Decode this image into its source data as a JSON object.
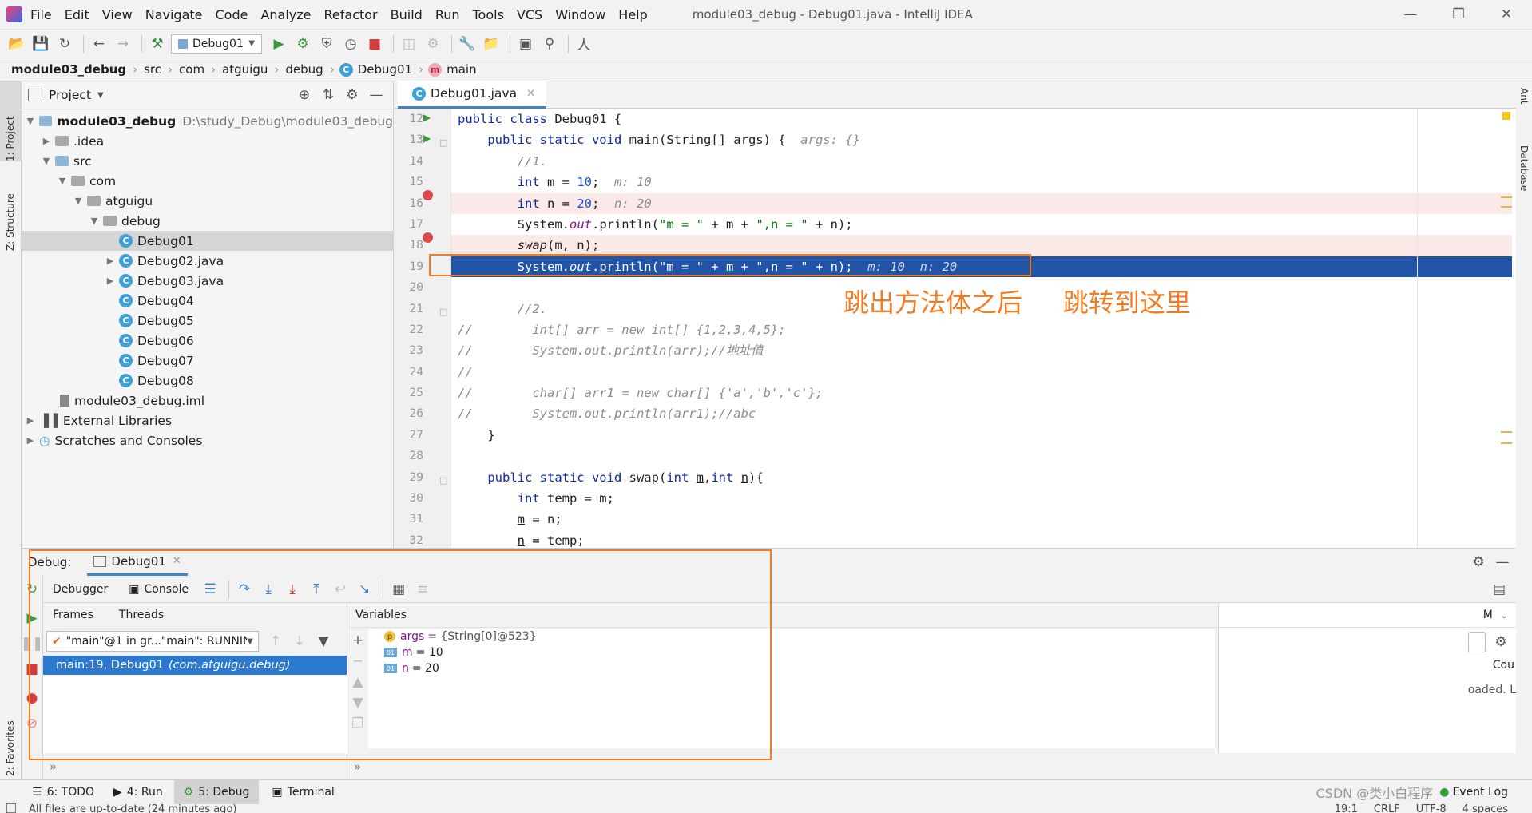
{
  "window": {
    "title": "module03_debug - Debug01.java - IntelliJ IDEA",
    "menu": [
      "File",
      "Edit",
      "View",
      "Navigate",
      "Code",
      "Analyze",
      "Refactor",
      "Build",
      "Run",
      "Tools",
      "VCS",
      "Window",
      "Help"
    ]
  },
  "toolbar": {
    "run_config": "Debug01"
  },
  "breadcrumb": [
    "module03_debug",
    "src",
    "com",
    "atguigu",
    "debug",
    "Debug01",
    "main"
  ],
  "side_tabs": {
    "project": "1: Project",
    "structure": "Z: Structure",
    "favorites": "2: Favorites",
    "ant": "Ant",
    "database": "Database"
  },
  "project": {
    "title": "Project",
    "root_name": "module03_debug",
    "root_path": "D:\\study_Debug\\module03_debug",
    "idea": ".idea",
    "src": "src",
    "com": "com",
    "atguigu": "atguigu",
    "debug": "debug",
    "classes": [
      "Debug01",
      "Debug02.java",
      "Debug03.java",
      "Debug04",
      "Debug05",
      "Debug06",
      "Debug07",
      "Debug08"
    ],
    "iml": "module03_debug.iml",
    "external": "External Libraries",
    "scratches": "Scratches and Consoles"
  },
  "editor": {
    "tab": "Debug01.java",
    "line_numbers": [
      "12",
      "13",
      "14",
      "15",
      "16",
      "17",
      "18",
      "19",
      "20",
      "21",
      "22",
      "23",
      "24",
      "25",
      "26",
      "27",
      "28",
      "29",
      "30",
      "31",
      "32"
    ],
    "annotation": "跳出方法体之后     跳转到这里"
  },
  "debug": {
    "label": "Debug:",
    "session": "Debug01",
    "tab_debugger": "Debugger",
    "tab_console": "Console",
    "frames": "Frames",
    "threads": "Threads",
    "thread_select": "\"main\"@1 in gr...\"main\": RUNNING",
    "frame_main": "main:19, Debug01",
    "frame_pkg": "(com.atguigu.debug)",
    "variables": "Variables",
    "vars": [
      {
        "badge": "p",
        "name": "args",
        "value": "= {String[0]@523}"
      },
      {
        "badge": "01",
        "name": "m",
        "value": "= 10"
      },
      {
        "badge": "01",
        "name": "n",
        "value": "= 20"
      }
    ],
    "right_col_header": "M",
    "right_col_cell": "Cou",
    "right_col_text": "oaded. L"
  },
  "bottom_tabs": [
    "6: TODO",
    "4: Run",
    "5: Debug",
    "Terminal"
  ],
  "event_log": "Event Log",
  "watermark": "CSDN @类小白程序",
  "status": {
    "left": "All files are up-to-date (24 minutes ago)",
    "position": "19:1",
    "line_sep": "CRLF",
    "encoding": "UTF-8",
    "indent": "4 spaces"
  }
}
